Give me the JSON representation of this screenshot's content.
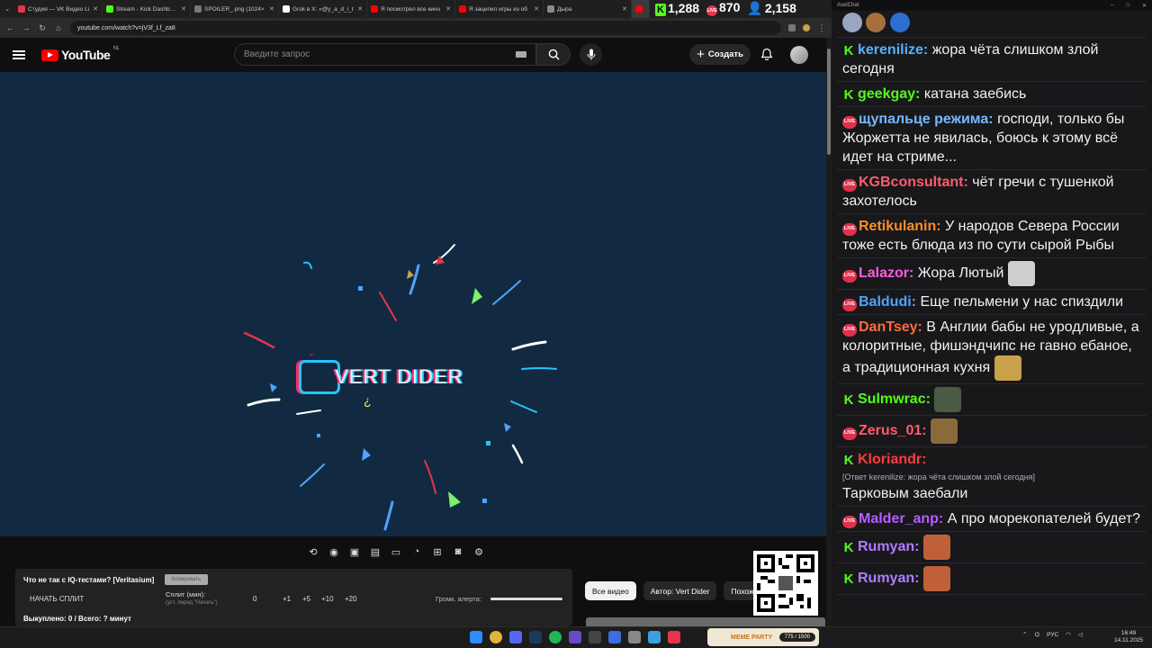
{
  "browser": {
    "tabs": [
      {
        "title": "Студия — VK Видео Li",
        "color": "#e8334b"
      },
      {
        "title": "Stream - Kick Dashboard",
        "color": "#53fc18"
      },
      {
        "title": "SPOILER_.png (1024×",
        "color": "#777777"
      },
      {
        "title": "Grok в X: «@y_a_d_i_t",
        "color": "#ffffff"
      },
      {
        "title": "Я посмотрел все кино",
        "color": "#ff0000"
      },
      {
        "title": "Я зацепил игры из об",
        "color": "#ff0000"
      },
      {
        "title": "Дыра",
        "color": "#8a8a8a"
      },
      {
        "title": "",
        "color": "#ff0000"
      }
    ],
    "url": "youtube.com/watch?v=jV3f_Lf_za8"
  },
  "stats": {
    "kick_viewers": "1,288",
    "live_viewers": "870",
    "total_viewers": "2,158",
    "kick_badge": "K",
    "live_badge": "LIVE"
  },
  "youtube": {
    "logo_text": "YouTube",
    "region": "NL",
    "search_placeholder": "Введите запрос",
    "create_label": "Создать"
  },
  "video": {
    "logo_text": "VERT DIDER"
  },
  "split": {
    "title": "Что не так с IQ-тестами? [Veritasium]",
    "copy_label": "Копировать",
    "start_label": "НАЧАТЬ СПЛИТ",
    "split_label": "Сплит (мин):",
    "split_hint": "(уст. перед \"Начать\")",
    "zero": "0",
    "inc": [
      "+1",
      "+5",
      "+10",
      "+20"
    ],
    "volume_label": "Громк. алерта:",
    "total": "Выкуплено: 0 / Всего: ? минут"
  },
  "chips": [
    "Все видео",
    "Автор: Vert Dider",
    "Похожие"
  ],
  "chat": {
    "window_title": "AxelChat",
    "messages": [
      {
        "badge": "kick",
        "name": "kerenilize:",
        "color": "#5ab0ff",
        "text": "жора чёта слишком злой сегодня",
        "reply": ""
      },
      {
        "badge": "kick",
        "name": "geekgay:",
        "color": "#53fc18",
        "text": "катана заебись",
        "reply": ""
      },
      {
        "badge": "live",
        "name": "щупальце режима:",
        "color": "#74b9ff",
        "text": "господи, только бы Жоржетта не явилась, боюсь к этому всё идет на стриме...",
        "reply": ""
      },
      {
        "badge": "live",
        "name": "KGBconsultant:",
        "color": "#ff5c6c",
        "text": "чёт гречи с тушенкой захотелось",
        "reply": ""
      },
      {
        "badge": "live",
        "name": "Retikulanin:",
        "color": "#ff8c2a",
        "text": "У народов Севера России тоже есть блюда из по сути сырой Рыбы",
        "reply": ""
      },
      {
        "badge": "live",
        "name": "Lalazor:",
        "color": "#ff5ce1",
        "text": "Жора Лютый",
        "reply": "",
        "emote": "#cfcfcf"
      },
      {
        "badge": "live",
        "name": "Baldudi:",
        "color": "#4fa3ff",
        "text": "Еще пельмени у нас спиздили",
        "reply": ""
      },
      {
        "badge": "live",
        "name": "DanTsey:",
        "color": "#ff6a3d",
        "text": "В Англии бабы не уродливые, а колоритные, фишэндчипс не гавно ебаное, а традиционная кухня",
        "reply": "",
        "emote": "#c9a24a"
      },
      {
        "badge": "kick",
        "name": "Sulmwrac:",
        "color": "#53fc18",
        "text": "",
        "reply": "",
        "emote": "#4a5a44"
      },
      {
        "badge": "live",
        "name": "Zerus_01:",
        "color": "#ff5c6c",
        "text": "",
        "reply": "",
        "emote": "#8a6a3a"
      },
      {
        "badge": "kick",
        "name": "Kloriandr:",
        "color": "#ff3b3b",
        "text": "Тарковым заебали",
        "reply": "[Ответ kerenilize: жора чёта слишком злой сегодня]"
      },
      {
        "badge": "live",
        "name": "Malder_anp:",
        "color": "#b85cff",
        "text": "А про морекопателей будет?",
        "reply": ""
      },
      {
        "badge": "kick",
        "name": "Rumyan:",
        "color": "#b07cff",
        "text": "",
        "reply": "",
        "emote": "#c0603a"
      },
      {
        "badge": "kick",
        "name": "Rumyan:",
        "color": "#b07cff",
        "text": "",
        "reply": "",
        "emote": "#c0603a"
      }
    ]
  },
  "taskbar": {
    "meme_label": "MEME PARTY",
    "meme_count": "775 / 1500",
    "lang": "РУС",
    "time": "16:49",
    "date": "14.11.2025"
  }
}
